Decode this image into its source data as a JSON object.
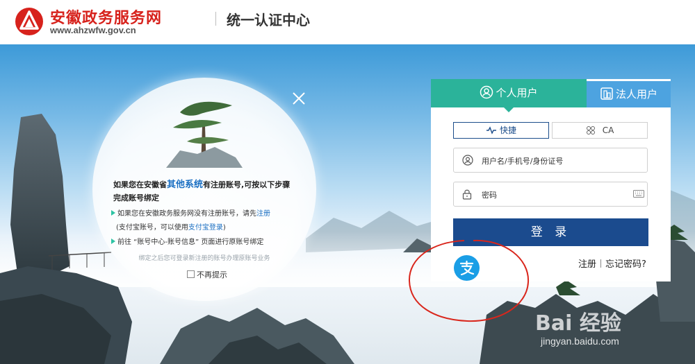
{
  "header": {
    "site_name": "安徽政务服务网",
    "site_url": "www.ahzwfw.gov.cn",
    "center_title": "统一认证中心"
  },
  "tip": {
    "title_prefix": "如果您在安徽省",
    "title_highlight": "其他系统",
    "title_suffix": "有注册账号,可按以下步骤完成账号绑定",
    "line1_text": "如果您在安徽政务服务网没有注册账号，请先",
    "line1_link": "注册",
    "line2_prefix": "(支付宝账号，可以使用",
    "line2_link": "支付宝登录",
    "line2_suffix": ")",
    "line3_text": "前往 “账号中心-账号信息” 页面进行原账号绑定",
    "note": "绑定之后您可登录新注册的账号办理原账号业务",
    "checkbox_label": "不再提示"
  },
  "login": {
    "tabs": [
      {
        "label": "个人用户",
        "active": true
      },
      {
        "label": "法人用户",
        "active": false
      }
    ],
    "modes": [
      {
        "label": "快捷",
        "active": true
      },
      {
        "label": "CA",
        "active": false
      }
    ],
    "username_placeholder": "用户名/手机号/身份证号",
    "password_placeholder": "密码",
    "login_button": "登 录",
    "register_link": "注册",
    "forgot_link": "忘记密码?"
  },
  "watermark": {
    "logo": "Bai 经验",
    "url": "jingyan.baidu.com"
  },
  "colors": {
    "brand_red": "#d7221c",
    "tab_active": "#2bb39a",
    "tab_inactive": "#4da3e0",
    "login_button": "#1b4b8e",
    "alipay_blue": "#1a9ee6",
    "annotation_red": "#d9261c"
  }
}
